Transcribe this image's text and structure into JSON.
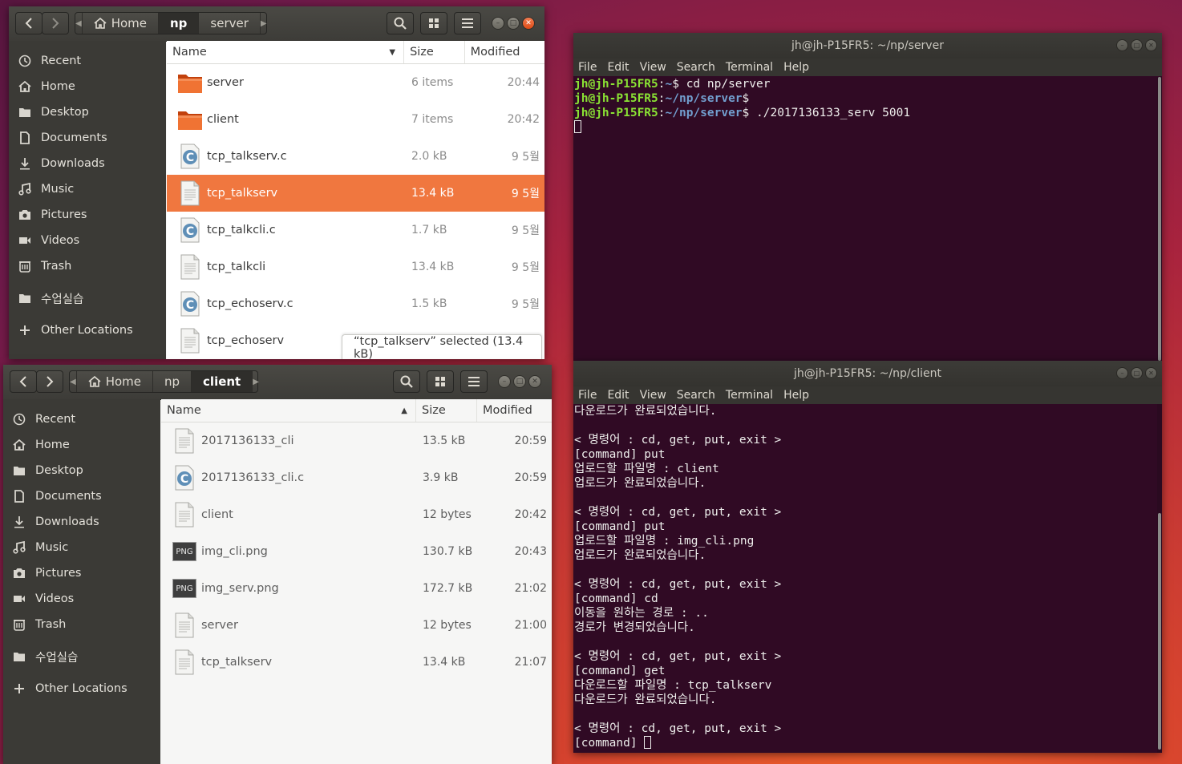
{
  "fm_server": {
    "breadcrumbs": {
      "home": "Home",
      "np": "np",
      "server": "server"
    },
    "columns": {
      "name": "Name",
      "size": "Size",
      "modified": "Modified"
    },
    "sidebar": {
      "items": [
        {
          "label": "Recent"
        },
        {
          "label": "Home"
        },
        {
          "label": "Desktop"
        },
        {
          "label": "Documents"
        },
        {
          "label": "Downloads"
        },
        {
          "label": "Music"
        },
        {
          "label": "Pictures"
        },
        {
          "label": "Videos"
        },
        {
          "label": "Trash"
        },
        {
          "label": "수업실습"
        },
        {
          "label": "Other Locations"
        }
      ]
    },
    "files": [
      {
        "name": "server",
        "size": "6 items",
        "modified": "20:44",
        "icon": "folder-icon"
      },
      {
        "name": "client",
        "size": "7 items",
        "modified": "20:42",
        "icon": "folder-icon"
      },
      {
        "name": "tcp_talkserv.c",
        "size": "2.0 kB",
        "modified": "9 5월",
        "icon": "c-source-icon"
      },
      {
        "name": "tcp_talkserv",
        "size": "13.4 kB",
        "modified": "9 5월",
        "icon": "binary-file-icon",
        "selected": true
      },
      {
        "name": "tcp_talkcli.c",
        "size": "1.7 kB",
        "modified": "9 5월",
        "icon": "c-source-icon"
      },
      {
        "name": "tcp_talkcli",
        "size": "13.4 kB",
        "modified": "9 5월",
        "icon": "binary-file-icon"
      },
      {
        "name": "tcp_echoserv.c",
        "size": "1.5 kB",
        "modified": "9 5월",
        "icon": "c-source-icon"
      },
      {
        "name": "tcp_echoserv",
        "size": "",
        "modified": "",
        "icon": "binary-file-icon"
      }
    ],
    "status": "“tcp_talkserv” selected  (13.4 kB)"
  },
  "fm_client": {
    "breadcrumbs": {
      "home": "Home",
      "np": "np",
      "client": "client"
    },
    "columns": {
      "name": "Name",
      "size": "Size",
      "modified": "Modified"
    },
    "sidebar": {
      "items": [
        {
          "label": "Recent"
        },
        {
          "label": "Home"
        },
        {
          "label": "Desktop"
        },
        {
          "label": "Documents"
        },
        {
          "label": "Downloads"
        },
        {
          "label": "Music"
        },
        {
          "label": "Pictures"
        },
        {
          "label": "Videos"
        },
        {
          "label": "Trash"
        },
        {
          "label": "수업실습"
        },
        {
          "label": "Other Locations"
        }
      ]
    },
    "files": [
      {
        "name": "2017136133_cli",
        "size": "13.5 kB",
        "modified": "20:59",
        "icon": "binary-file-icon"
      },
      {
        "name": "2017136133_cli.c",
        "size": "3.9 kB",
        "modified": "20:59",
        "icon": "c-source-icon"
      },
      {
        "name": "client",
        "size": "12 bytes",
        "modified": "20:42",
        "icon": "text-file-icon"
      },
      {
        "name": "img_cli.png",
        "size": "130.7 kB",
        "modified": "20:43",
        "icon": "png-icon"
      },
      {
        "name": "img_serv.png",
        "size": "172.7 kB",
        "modified": "21:02",
        "icon": "png-icon"
      },
      {
        "name": "server",
        "size": "12 bytes",
        "modified": "21:00",
        "icon": "text-file-icon"
      },
      {
        "name": "tcp_talkserv",
        "size": "13.4 kB",
        "modified": "21:07",
        "icon": "binary-file-icon"
      }
    ],
    "png_label": "PNG"
  },
  "term_server": {
    "title": "jh@jh-P15FR5: ~/np/server",
    "menu": [
      "File",
      "Edit",
      "View",
      "Search",
      "Terminal",
      "Help"
    ],
    "lines": [
      {
        "user": "jh@jh-P15FR5",
        "colon": ":",
        "path": "~",
        "prompt": "$ ",
        "cmd": "cd np/server"
      },
      {
        "user": "jh@jh-P15FR5",
        "colon": ":",
        "path": "~/np/server",
        "prompt": "$",
        "cmd": ""
      },
      {
        "user": "jh@jh-P15FR5",
        "colon": ":",
        "path": "~/np/server",
        "prompt": "$ ",
        "cmd": "./2017136133_serv 5001"
      }
    ]
  },
  "term_client": {
    "title": "jh@jh-P15FR5: ~/np/client",
    "menu": [
      "File",
      "Edit",
      "View",
      "Search",
      "Terminal",
      "Help"
    ],
    "lines": [
      "다운로드가 완료되었습니다.",
      "",
      "< 명령어 : cd, get, put, exit >",
      "[command] put",
      "업로드할 파일명 : client",
      "업로드가 완료되었습니다.",
      "",
      "< 명령어 : cd, get, put, exit >",
      "[command] put",
      "업로드할 파일명 : img_cli.png",
      "업로드가 완료되었습니다.",
      "",
      "< 명령어 : cd, get, put, exit >",
      "[command] cd",
      "이동을 원하는 경로 : ..",
      "경로가 변경되었습니다.",
      "",
      "< 명령어 : cd, get, put, exit >",
      "[command] get",
      "다운로드할 파일명 : tcp_talkserv",
      "다운로드가 완료되었습니다.",
      "",
      "< 명령어 : cd, get, put, exit >"
    ],
    "last_prompt": "[command] "
  }
}
